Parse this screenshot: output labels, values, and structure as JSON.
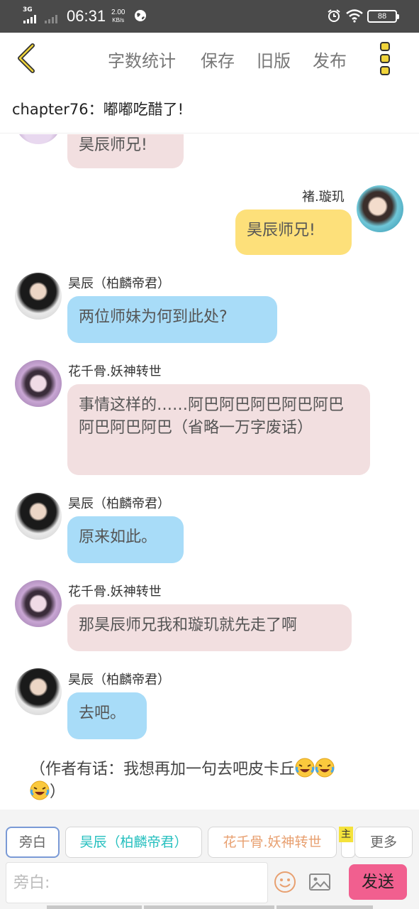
{
  "status_bar": {
    "network": "3G",
    "time": "06:31",
    "speed_value": "2.00",
    "speed_unit": "KB/s",
    "battery": "88"
  },
  "toolbar": {
    "word_count": "字数统计",
    "save": "保存",
    "old_version": "旧版",
    "publish": "发布"
  },
  "chapter": {
    "title": "chapter76：嘟嘟吃醋了!"
  },
  "messages": [
    {
      "name": "",
      "text": "昊辰师兄!"
    },
    {
      "name": "褚.璇玑",
      "text": "昊辰师兄!"
    },
    {
      "name": "昊辰（柏麟帝君）",
      "text": "两位师妹为何到此处?"
    },
    {
      "name": "花千骨.妖神转世",
      "text": "事情这样的……阿巴阿巴阿巴阿巴阿巴阿巴阿巴阿巴（省略一万字废话）"
    },
    {
      "name": "昊辰（柏麟帝君）",
      "text": "原来如此。"
    },
    {
      "name": "花千骨.妖神转世",
      "text": "那昊辰师兄我和璇玑就先走了啊"
    },
    {
      "name": "昊辰（柏麟帝君）",
      "text": "去吧。"
    }
  ],
  "aside_note": "（作者有话：我想再加一句去吧皮卡丘",
  "aside_end": "）",
  "bottom": {
    "roles": [
      "旁白",
      "昊辰（柏麟帝君）",
      "花千骨.妖神转世"
    ],
    "main_mark": "主",
    "more": "更多",
    "input_placeholder": "旁白:",
    "send": "发送"
  },
  "colors": {
    "pink_bubble": "#f2dfe0",
    "blue_bubble": "#a8dcf8",
    "yellow_bubble": "#fde07a",
    "send_button": "#f15f8f",
    "accent_yellow": "#f0d43a"
  }
}
